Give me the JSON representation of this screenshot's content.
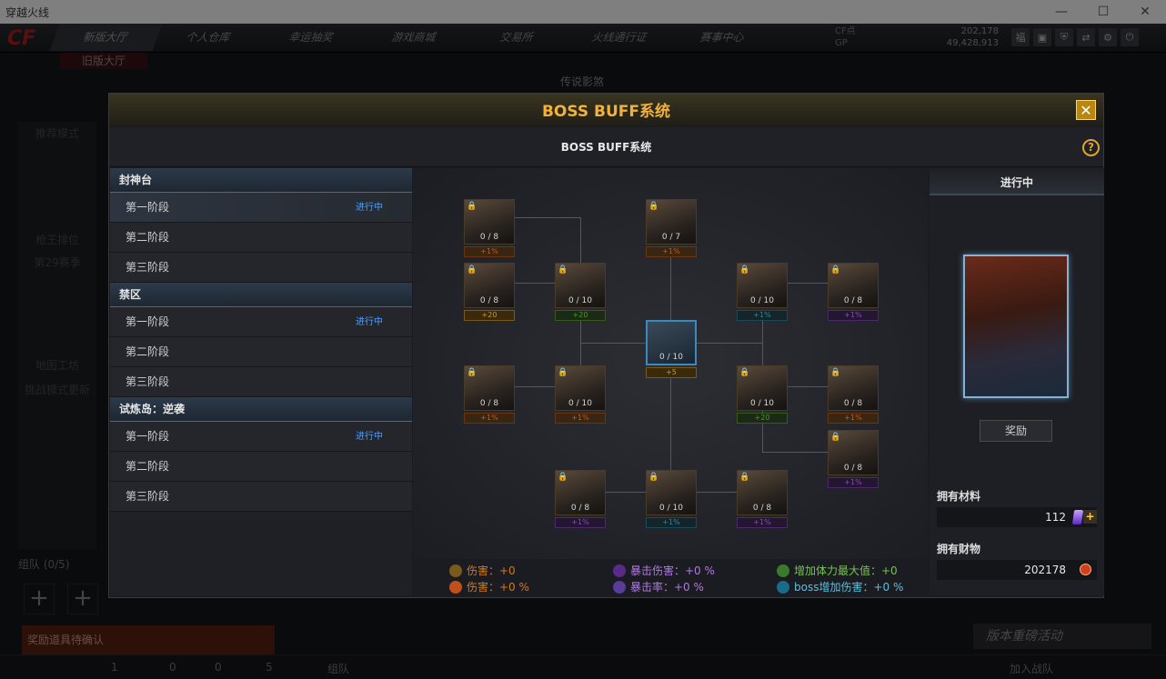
{
  "window": {
    "title": "穿越火线",
    "min": "—",
    "max": "☐",
    "close": "✕"
  },
  "topnav": {
    "logo": "CF",
    "tabs": [
      "新版大厅",
      "个人仓库",
      "幸运抽奖",
      "游戏商城",
      "交易所",
      "火线通行证",
      "赛事中心"
    ],
    "old_hall": "旧版大厅",
    "cf_label": "CF点",
    "gp_label": "GP",
    "cf_value": "202,178",
    "gp_value": "49,428,913"
  },
  "background": {
    "legend": "传说影煞",
    "recommend": "推荐模式",
    "king": "枪王排位",
    "season": "第29赛季",
    "map": "地图工坊",
    "challenge": "挑战模式更新",
    "team": "组队 (0/5)",
    "reward_confirm": "奖励道具待确认",
    "activity": "版本重磅活动",
    "bottom": {
      "team": "组队",
      "join": "加入战队",
      "n1": "1",
      "n2": "0",
      "n3": "0",
      "n4": "5"
    }
  },
  "modal": {
    "title": "BOSS BUFF系统",
    "subtitle": "BOSS BUFF系统",
    "close": "✕",
    "help": "?",
    "groups": [
      {
        "name": "封神台",
        "stages": [
          {
            "label": "第一阶段",
            "status": "进行中",
            "selected": true
          },
          {
            "label": "第二阶段",
            "status": ""
          },
          {
            "label": "第三阶段",
            "status": ""
          }
        ]
      },
      {
        "name": "禁区",
        "stages": [
          {
            "label": "第一阶段",
            "status": "进行中"
          },
          {
            "label": "第二阶段",
            "status": ""
          },
          {
            "label": "第三阶段",
            "status": ""
          }
        ]
      },
      {
        "name": "试炼岛：逆袭",
        "stages": [
          {
            "label": "第一阶段",
            "status": "进行中"
          },
          {
            "label": "第二阶段",
            "status": ""
          },
          {
            "label": "第三阶段",
            "status": ""
          }
        ]
      }
    ],
    "nodes": [
      {
        "count": "0 / 8",
        "bonus": "+1%",
        "kind": "orange",
        "locked": true
      },
      {
        "count": "0 / 7",
        "bonus": "+1%",
        "kind": "orange",
        "locked": true
      },
      {
        "count": "0 / 8",
        "bonus": "+20",
        "kind": "gold",
        "locked": true
      },
      {
        "count": "0 / 10",
        "bonus": "+20",
        "kind": "green",
        "locked": true
      },
      {
        "count": "0 / 10",
        "bonus": "+1%",
        "kind": "teal",
        "locked": true
      },
      {
        "count": "0 / 8",
        "bonus": "+1%",
        "kind": "purple",
        "locked": true
      },
      {
        "count": "0 / 10",
        "bonus": "+5",
        "kind": "gold",
        "locked": false
      },
      {
        "count": "0 / 8",
        "bonus": "+1%",
        "kind": "orange",
        "locked": true
      },
      {
        "count": "0 / 10",
        "bonus": "+1%",
        "kind": "orange",
        "locked": true
      },
      {
        "count": "0 / 10",
        "bonus": "+20",
        "kind": "green",
        "locked": true
      },
      {
        "count": "0 / 8",
        "bonus": "+1%",
        "kind": "orange",
        "locked": true
      },
      {
        "count": "0 / 8",
        "bonus": "+1%",
        "kind": "purple",
        "locked": true
      },
      {
        "count": "0 / 8",
        "bonus": "+1%",
        "kind": "purple",
        "locked": true
      },
      {
        "count": "0 / 10",
        "bonus": "+1%",
        "kind": "teal",
        "locked": true
      },
      {
        "count": "0 / 8",
        "bonus": "+1%",
        "kind": "purple",
        "locked": true
      }
    ],
    "stats": {
      "damage": "伤害：+0",
      "damage_pct": "伤害：+0 %",
      "crit_dmg": "暴击伤害：+0 %",
      "crit_rate": "暴击率：+0 %",
      "max_hp": "增加体力最大值：+0",
      "boss_dmg": "boss增加伤害：+0 %"
    },
    "colors": {
      "damage": "#d07a1a",
      "crit": "#9a5ad0",
      "hp": "#5ab03a",
      "boss": "#3aa0c0",
      "accent": "#f0b23c"
    },
    "right": {
      "status": "进行中",
      "reward_button": "奖励",
      "materials_label": "拥有材料",
      "materials_value": "112",
      "wealth_label": "拥有财物",
      "wealth_value": "202178"
    }
  }
}
